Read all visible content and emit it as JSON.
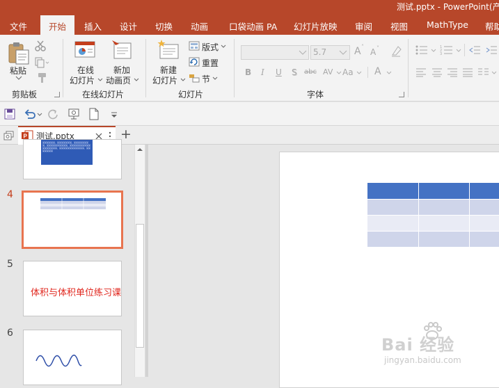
{
  "window": {
    "title": "测试.pptx  -  PowerPoint(产"
  },
  "tabs": [
    "文件",
    "开始",
    "插入",
    "设计",
    "切换",
    "动画",
    "口袋动画 PA",
    "幻灯片放映",
    "审阅",
    "视图",
    "MathType",
    "帮助"
  ],
  "ribbon": {
    "clipboard": {
      "paste_label": "粘贴",
      "group_label": "剪贴板"
    },
    "online_slides": {
      "online_slide_line1": "在线",
      "online_slide_line2": "幻灯片",
      "new_online_page_line1": "新加",
      "new_online_page_line2": "动画页",
      "group_label": "在线幻灯片"
    },
    "slides": {
      "new_slide_line1": "新建",
      "new_slide_line2": "幻灯片",
      "layout_label": "版式",
      "reset_label": "重置",
      "section_label": "节",
      "group_label": "幻灯片"
    },
    "font": {
      "font_name": "",
      "font_size": "5.7",
      "bold": "B",
      "italic": "I",
      "underline": "U",
      "shadow": "S",
      "strike": "abc",
      "spacing": "AV",
      "case": "Aa",
      "color": "A",
      "grow": "A",
      "shrink": "A",
      "group_label": "字体"
    },
    "paragraph": {}
  },
  "document": {
    "tab_name": "测试.pptx",
    "new_tab": "+"
  },
  "slides_panel": {
    "numbers": [
      "4",
      "5",
      "6"
    ],
    "slide5_text": "体积与体积单位练习课",
    "slide3_preview_text": "某某某某某某，某某某某某某某，某某某某某某某某，某某某某某某某某某某，某某某某某某某某某某某某某某某某某，某某某某某某某某某某某某，某某某某某某某"
  },
  "watermark": {
    "brand": "Bai 经验",
    "url": "jingyan.baidu.com"
  },
  "colors": {
    "accent": "#b7472a",
    "table_header": "#4472c4",
    "table_row_a": "#cfd5ea",
    "table_row_b": "#e9ebf5",
    "selection": "#e8744f"
  }
}
